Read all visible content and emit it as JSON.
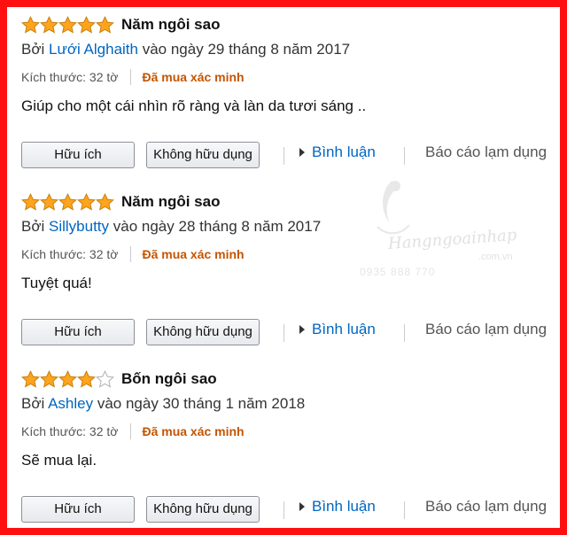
{
  "reviews": [
    {
      "rating": 5,
      "title": "Năm ngôi sao",
      "by_prefix": "Bởi",
      "author": "Lưới Alghaith",
      "date_text": "vào ngày 29 tháng 8 năm 2017",
      "size_text": "Kích thước: 32 tờ",
      "verified": "Đã mua xác minh",
      "body": "Giúp cho một cái nhìn rõ ràng và làn da tươi sáng .."
    },
    {
      "rating": 5,
      "title": "Năm ngôi sao",
      "by_prefix": "Bởi",
      "author": "Sillybutty",
      "date_text": "vào ngày 28 tháng 8 năm 2017",
      "size_text": "Kích thước: 32 tờ",
      "verified": "Đã mua xác minh",
      "body": "Tuyệt quá!"
    },
    {
      "rating": 4,
      "title": "Bốn ngôi sao",
      "by_prefix": "Bởi",
      "author": "Ashley",
      "date_text": "vào ngày 30 tháng 1 năm 2018",
      "size_text": "Kích thước: 32 tờ",
      "verified": "Đã mua xác minh",
      "body": "Sẽ mua lại."
    }
  ],
  "actions": {
    "helpful": "Hữu ích",
    "not_helpful": "Không hữu dụng",
    "comment": "Bình luận",
    "report": "Báo cáo lạm dụng"
  },
  "watermark": {
    "brand": "Hangngoainhap",
    "domain": ".com.vn",
    "phone": "0935 888 770"
  },
  "colors": {
    "border": "#ff1010",
    "star": "#ffa41c",
    "link": "#0066c0",
    "verified": "#c45500"
  }
}
